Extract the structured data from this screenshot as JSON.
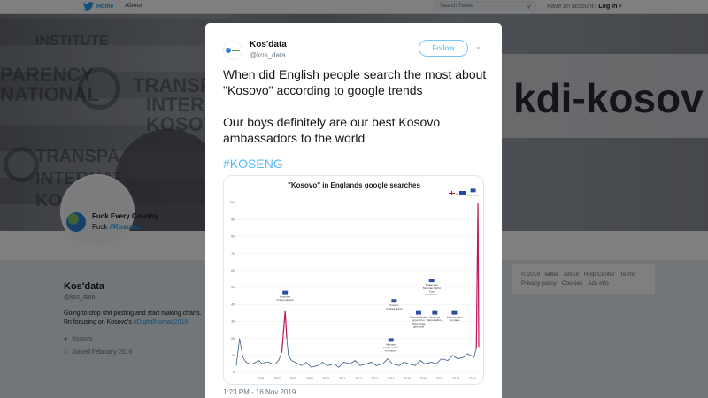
{
  "topbar": {
    "home_label": "Home",
    "about_label": "About",
    "search_placeholder": "Search Twitter",
    "account_prompt": "Have an account?",
    "login_label": "Log in"
  },
  "banner": {
    "texts": [
      "INSTITUTE",
      "PARENCY",
      "NATIONAL",
      "TRANSPA",
      "INTERNAT",
      "KOSOVA",
      "TRANSPA",
      "INTERNAT",
      "KOSO",
      "kdi-kosov"
    ]
  },
  "avatar_card": {
    "line1": "Fuck Every Country",
    "line2_prefix": "Fuck ",
    "line2_tag": "#Kosovo."
  },
  "profile": {
    "name": "Kos'data",
    "handle": "@kos_data",
    "bio_text": "Going to stop shit posting and start making charts. Rn focusing on Kosovo's",
    "bio_tag": "#DigitalNomad2019",
    "location": "Kosovo",
    "joined": "Joined February 2016"
  },
  "footer": {
    "links": [
      "© 2019 Twitter",
      "About",
      "Help Center",
      "Terms",
      "Privacy policy",
      "Cookies",
      "Ads info"
    ]
  },
  "tweet": {
    "author_name": "Kos'data",
    "author_handle": "@kos_data",
    "follow_label": "Follow",
    "paragraph1": "When did English people search the most about \"Kosovo\" according to google trends",
    "paragraph2": "Our boys definitely are our best Kosovo ambassadors to the world",
    "hashtag": "#KOSENG",
    "timestamp": "1:23 PM - 16 Nov 2019"
  },
  "chart_data": {
    "type": "line",
    "title": "\"Kosovo\" in Englands  google searches",
    "x_tick_labels": [
      "2006",
      "2007",
      "2008",
      "2009",
      "2010",
      "2011",
      "2012",
      "2013",
      "2014",
      "2015",
      "2016",
      "2017",
      "2018",
      "2019"
    ],
    "y_tick_labels": [
      "0",
      "10",
      "20",
      "30",
      "40",
      "50",
      "60",
      "70",
      "80",
      "90",
      "100"
    ],
    "ylim": [
      0,
      100
    ],
    "xlim": [
      2005,
      2019.9
    ],
    "series_color": "#3a5a8c",
    "highlight_color": "#c2185b",
    "x": [
      2005.0,
      2005.2,
      2005.4,
      2005.6,
      2005.8,
      2006.0,
      2006.2,
      2006.4,
      2006.6,
      2006.8,
      2007.0,
      2007.2,
      2007.4,
      2007.6,
      2007.8,
      2008.0,
      2008.1,
      2008.2,
      2008.4,
      2008.6,
      2008.8,
      2009.0,
      2009.3,
      2009.6,
      2010.0,
      2010.3,
      2010.6,
      2011.0,
      2011.3,
      2011.6,
      2012.0,
      2012.3,
      2012.6,
      2013.0,
      2013.3,
      2013.6,
      2014.0,
      2014.3,
      2014.6,
      2015.0,
      2015.3,
      2015.6,
      2016.0,
      2016.3,
      2016.6,
      2017.0,
      2017.3,
      2017.6,
      2018.0,
      2018.3,
      2018.6,
      2019.0,
      2019.2,
      2019.4,
      2019.6,
      2019.75,
      2019.85,
      2019.9
    ],
    "values": [
      4,
      20,
      9,
      6,
      5,
      5,
      6,
      7,
      5,
      6,
      6,
      5,
      5,
      7,
      12,
      36,
      20,
      10,
      7,
      6,
      5,
      4,
      6,
      3,
      4,
      6,
      4,
      5,
      3,
      6,
      5,
      7,
      4,
      5,
      6,
      4,
      5,
      8,
      5,
      4,
      6,
      5,
      4,
      7,
      5,
      6,
      5,
      8,
      7,
      10,
      8,
      9,
      11,
      10,
      9,
      14,
      100,
      15
    ],
    "annotations": [
      {
        "label": "Kosovo's Independence",
        "x": 2008.0,
        "y": 45
      },
      {
        "label": "Kosovo football debut",
        "x": 2014.7,
        "y": 40
      },
      {
        "label": "Albanian brother video in Kosovo",
        "x": 2014.5,
        "y": 17
      },
      {
        "label": "Kosovo-Serbia ground for 2019 article gets viral",
        "x": 2016.2,
        "y": 33
      },
      {
        "label": "Drake and Stromae World Cup celebration",
        "x": 2017.0,
        "y": 52
      },
      {
        "label": "Dua Lipa debuts album",
        "x": 2017.2,
        "y": 33
      },
      {
        "label": "Kosovo wins 1st place",
        "x": 2018.4,
        "y": 33
      },
      {
        "label": "first game",
        "x": 2019.55,
        "y": 105
      }
    ]
  }
}
